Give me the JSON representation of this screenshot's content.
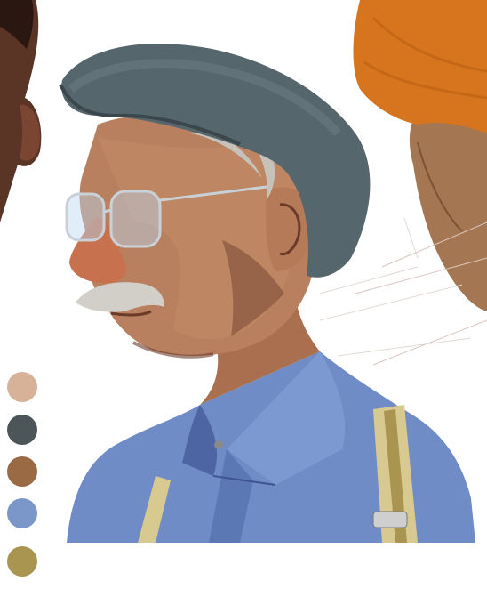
{
  "artwork": {
    "subject": "old-man-portrait-painting",
    "elements": [
      "flat-cap",
      "wire-rim-glasses",
      "grey-mustache",
      "blue-collared-shirt",
      "suspenders",
      "partial-portrait-left",
      "partial-portrait-right-orange-turban"
    ]
  },
  "palette": {
    "swatches": [
      {
        "name": "skin-light",
        "color": "#d8b298"
      },
      {
        "name": "cap-slate",
        "color": "#4c5659"
      },
      {
        "name": "skin-brown",
        "color": "#9a6a45"
      },
      {
        "name": "shirt-blue",
        "color": "#7b96c8"
      },
      {
        "name": "suspender-olive",
        "color": "#a99550"
      }
    ]
  },
  "colors": {
    "background": "#ffffff",
    "cap": "#56666d",
    "cap_highlight": "#6b7d84",
    "skin": "#b8805e",
    "skin_shadow": "#6b3b2a",
    "nose": "#c7714e",
    "mustache": "#d2cfc8",
    "hair": "#c6c2b9",
    "shirt": "#6f8cc7",
    "shirt_shadow": "#4d66a3",
    "suspender": "#d7c990",
    "suspender_shadow": "#a99550",
    "left_figure": "#5a3425",
    "turban": "#d7751e",
    "right_face": "#9a673e"
  }
}
